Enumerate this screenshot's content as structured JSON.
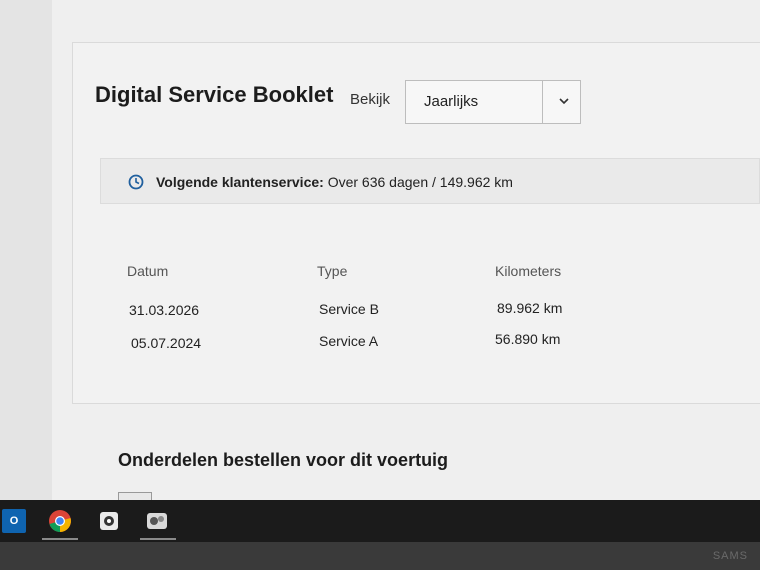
{
  "header": {
    "title": "Digital Service Booklet",
    "view_label": "Bekijk",
    "view_select": {
      "value": "Jaarlijks"
    }
  },
  "next_service": {
    "label": "Volgende klantenservice:",
    "value": "Over 636 dagen / 149.962 km",
    "icon": "clock-icon"
  },
  "service_table": {
    "headers": [
      "Datum",
      "Type",
      "Kilometers"
    ],
    "rows": [
      [
        "31.03.2026",
        "Service B",
        "89.962 km"
      ],
      [
        "05.07.2024",
        "Service A",
        "56.890 km"
      ]
    ]
  },
  "parts_section": {
    "title": "Onderdelen bestellen voor dit voertuig"
  },
  "taskbar": {
    "apps": [
      "outlook-icon",
      "chrome-icon",
      "app-icon",
      "app2-icon"
    ]
  },
  "monitor": {
    "brand": "SAMS"
  },
  "colors": {
    "accent": "#1f5f9e",
    "text": "#1c1c1c"
  }
}
